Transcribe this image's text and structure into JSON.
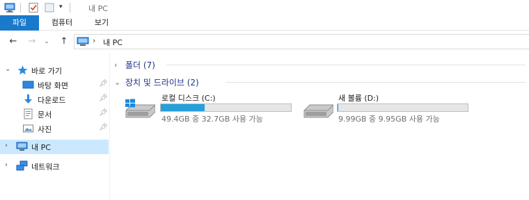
{
  "window": {
    "title": "내 PC"
  },
  "quick_access_toolbar": {
    "icons": [
      "computer-icon",
      "properties-check-icon",
      "new-folder-icon",
      "customize-dropdown-icon"
    ]
  },
  "ribbon": {
    "tabs": [
      {
        "label": "파일",
        "active": true
      },
      {
        "label": "컴퓨터"
      },
      {
        "label": "보기"
      }
    ],
    "file_tab_color": "#1979ca"
  },
  "address_bar": {
    "path": "내 PC"
  },
  "nav_pane": {
    "quick_access": {
      "label": "바로 가기",
      "items": [
        {
          "label": "바탕 화면",
          "icon": "desktop-icon"
        },
        {
          "label": "다운로드",
          "icon": "download-arrow-icon"
        },
        {
          "label": "문서",
          "icon": "document-icon"
        },
        {
          "label": "사진",
          "icon": "pictures-icon"
        }
      ]
    },
    "this_pc": {
      "label": "내 PC",
      "selected": true
    },
    "network": {
      "label": "네트워크"
    },
    "selection_color": "#cce8ff"
  },
  "content": {
    "folders_group": {
      "label": "폴더 (7)",
      "expanded": false
    },
    "drives_group": {
      "label": "장치 및 드라이브 (2)",
      "expanded": true
    },
    "drives": [
      {
        "name": "로컬 디스크 (C:)",
        "space_text": "49.4GB 중 32.7GB 사용 가능",
        "used_fraction": 0.338,
        "icon": "windows-drive-icon"
      },
      {
        "name": "새 볼륨 (D:)",
        "space_text": "9.99GB 중 9.95GB 사용 가능",
        "used_fraction": 0.004,
        "icon": "hard-drive-icon"
      }
    ],
    "usage_bar_color": "#26a0da",
    "group_label_color": "#1e3287"
  }
}
